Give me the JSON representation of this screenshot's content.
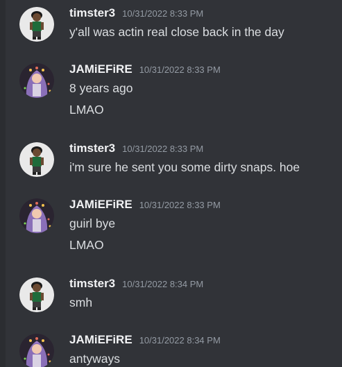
{
  "messages": [
    {
      "author": "timster3",
      "timestamp": "10/31/2022 8:33 PM",
      "avatar_icon": "timster-avatar-icon",
      "lines": [
        "y'all was actin real close back in the day"
      ]
    },
    {
      "author": "JAMiEFiRE",
      "timestamp": "10/31/2022 8:33 PM",
      "avatar_icon": "jamiefire-avatar-icon",
      "lines": [
        "8 years ago",
        "LMAO"
      ]
    },
    {
      "author": "timster3",
      "timestamp": "10/31/2022 8:33 PM",
      "avatar_icon": "timster-avatar-icon",
      "lines": [
        "i'm sure he sent you some dirty snaps. hoe"
      ]
    },
    {
      "author": "JAMiEFiRE",
      "timestamp": "10/31/2022 8:33 PM",
      "avatar_icon": "jamiefire-avatar-icon",
      "lines": [
        "guirl bye",
        "LMAO"
      ]
    },
    {
      "author": "timster3",
      "timestamp": "10/31/2022 8:34 PM",
      "avatar_icon": "timster-avatar-icon",
      "lines": [
        "smh"
      ]
    },
    {
      "author": "JAMiEFiRE",
      "timestamp": "10/31/2022 8:34 PM",
      "avatar_icon": "jamiefire-avatar-icon",
      "lines": [
        "antyways"
      ]
    }
  ],
  "colors": {
    "background": "#313338",
    "username": "#f2f3f5",
    "timestamp": "#949ba4",
    "message_text": "#dbdee1"
  }
}
